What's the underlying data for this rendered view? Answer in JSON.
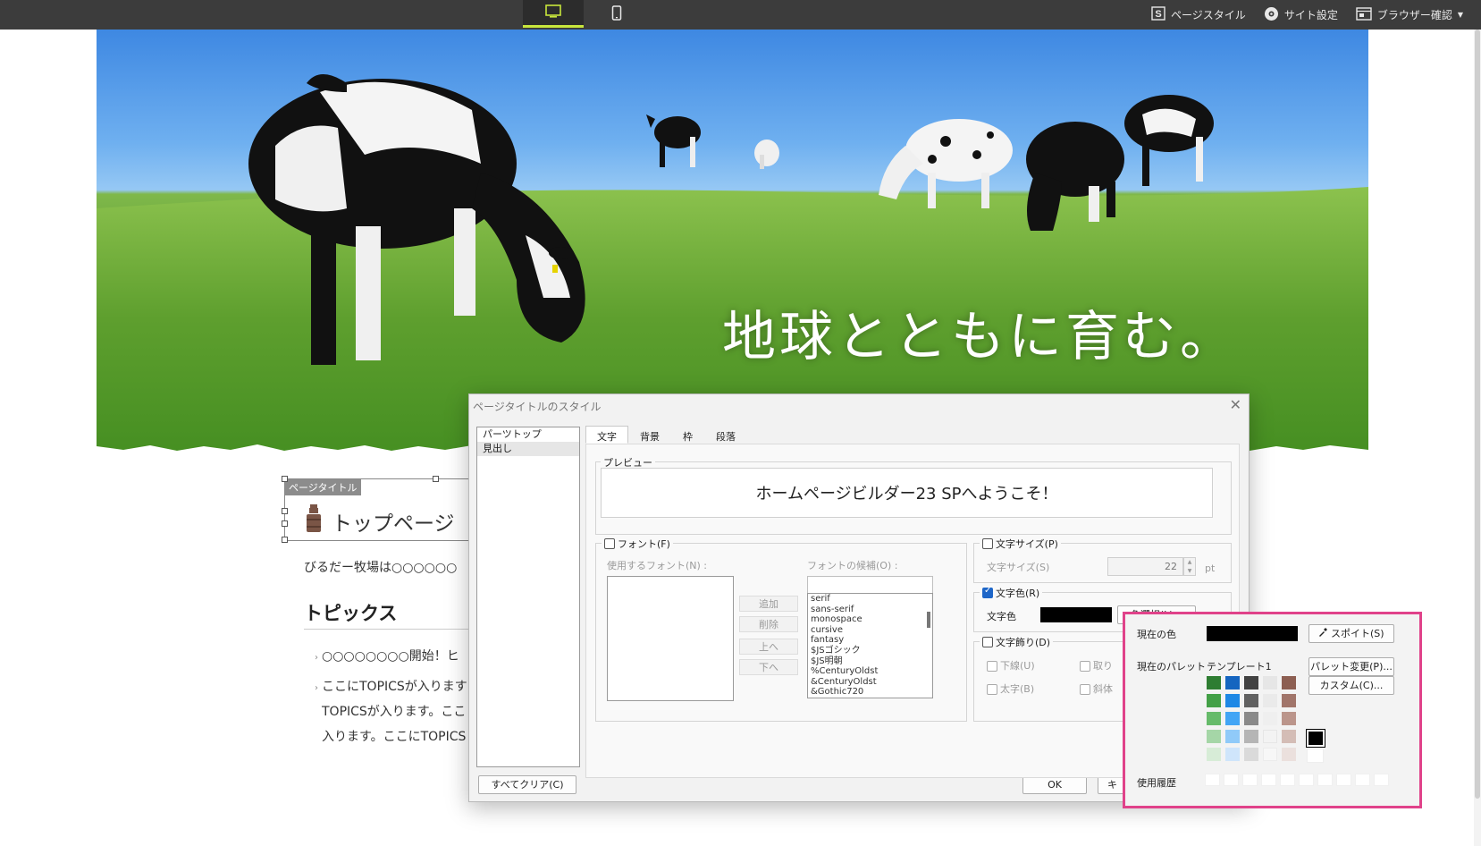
{
  "toolbar": {
    "view_pc": "pc-view",
    "view_mobile": "mobile-view",
    "page_style": "ページスタイル",
    "site_settings": "サイト設定",
    "browser_check": "ブラウザー確認"
  },
  "hero": {
    "caption": "地球とともに育む。"
  },
  "page": {
    "page_title_label": "ページタイトル",
    "page_title": "トップページ",
    "intro": "びるだー牧場は○○○○○○",
    "topics_heading": "トピックス",
    "topics": [
      "○○○○○○○○開始！ヒ",
      "ここにTOPICSが入ります",
      "TOPICSが入ります。ここ",
      "入ります。ここにTOPICS"
    ]
  },
  "dialog": {
    "title": "ページタイトルのスタイル",
    "list_items": [
      "パーツトップ",
      "見出し"
    ],
    "clear_all": "すべてクリア(C)",
    "ok": "OK",
    "cancel_partial": "キ",
    "tabs": [
      "文字",
      "背景",
      "枠",
      "段落"
    ],
    "preview_label": "プレビュー",
    "preview_text": "ホームページビルダー23 SPへようこそ！",
    "font_checkbox": "フォント(F)",
    "font_used_label": "使用するフォント(N) :",
    "font_candidates_label": "フォントの候補(O) :",
    "font_buttons": [
      "追加",
      "削除",
      "上へ",
      "下へ"
    ],
    "font_candidates": [
      "serif",
      "sans-serif",
      "monospace",
      "cursive",
      "fantasy",
      "$JSゴシック",
      "$JS明朝",
      "%CenturyOldst",
      "&CenturyOldst",
      "&Gothic720"
    ],
    "size_checkbox": "文字サイズ(P)",
    "size_label": "文字サイズ(S)",
    "size_value": "22",
    "size_unit": "pt",
    "color_checkbox": "文字色(R)",
    "color_label": "文字色",
    "color_select": "色選択(L)...",
    "decor_checkbox": "文字飾り(D)",
    "decor_items": [
      "下線(U)",
      "取り",
      "太字(B)",
      "斜体"
    ]
  },
  "palette": {
    "current_color_label": "現在の色",
    "eyedropper": "スポイト(S)",
    "current_palette_label": "現在のパレット",
    "palette_name": "テンプレート1",
    "change_palette": "パレット変更(P)...",
    "custom": "カスタム(C)...",
    "history_label": "使用履歴"
  },
  "colors": {
    "accent_green": "#c8e63c",
    "highlight_pink": "#e0428a",
    "checkbox_blue": "#1e66c8"
  }
}
